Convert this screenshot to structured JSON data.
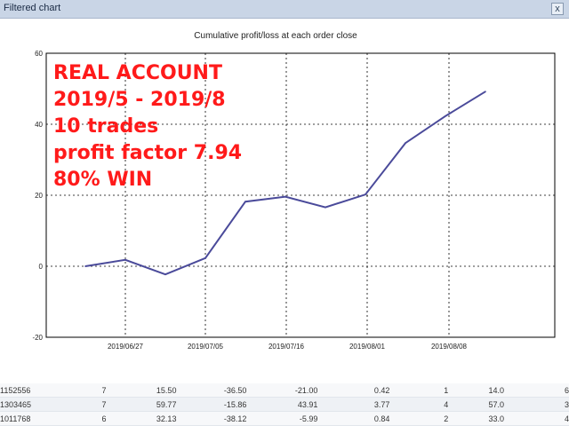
{
  "window": {
    "title": "Filtered chart",
    "close_glyph": "x"
  },
  "overlay_lines": [
    "REAL ACCOUNT",
    "2019/5 - 2019/8",
    "10 trades",
    "profit factor 7.94",
    "80% WIN"
  ],
  "colors": {
    "line": "#4a4a9a",
    "overlay_text": "#ff1a1a",
    "grid": "#000000"
  },
  "chart_data": {
    "type": "line",
    "title": "Cumulative profit/loss at each order close",
    "ylim": [
      -20,
      60
    ],
    "yticks": [
      60,
      40,
      20,
      0,
      -20
    ],
    "xticks": [
      "2019/06/27",
      "2019/07/05",
      "2019/07/16",
      "2019/08/01",
      "2019/08/08"
    ],
    "grid": true,
    "series": [
      {
        "values": [
          0,
          1.8,
          -2.3,
          2.3,
          18.2,
          19.6,
          16.6,
          20.2,
          34.7,
          42.3,
          49.2
        ]
      }
    ]
  },
  "table": {
    "rows": [
      [
        "1152556",
        "7",
        "15.50",
        "-36.50",
        "-21.00",
        "0.42",
        "1",
        "14.0",
        "6"
      ],
      [
        "1303465",
        "7",
        "59.77",
        "-15.86",
        "43.91",
        "3.77",
        "4",
        "57.0",
        "3"
      ],
      [
        "1011768",
        "6",
        "32.13",
        "-38.12",
        "-5.99",
        "0.84",
        "2",
        "33.0",
        "4"
      ]
    ]
  }
}
